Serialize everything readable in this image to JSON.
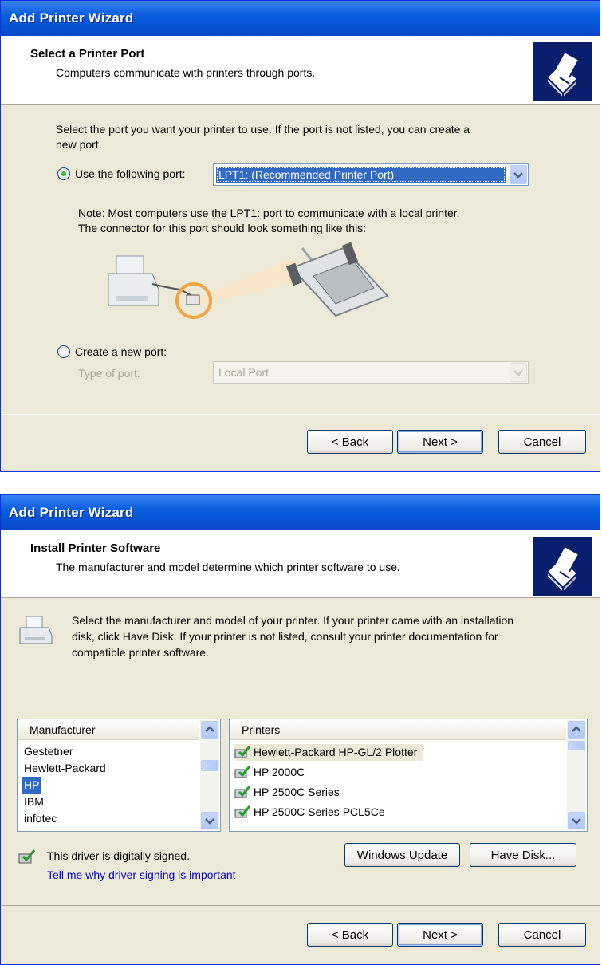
{
  "colors": {
    "title_bar": "#0a5fde",
    "dialog_bg": "#ece9d8",
    "selection": "#316ac5",
    "link": "#0000cc"
  },
  "wizard1": {
    "title": "Add Printer Wizard",
    "header_title": "Select a Printer Port",
    "header_subtitle": "Computers communicate with printers through ports.",
    "intro_line1": "Select the port you want your printer to use.  If the port is not listed, you can create a",
    "intro_line2": "new port.",
    "use_port_label": "Use the following port:",
    "port_value": "LPT1: (Recommended Printer Port)",
    "note_line1": "Note: Most computers use the LPT1: port to communicate with a local printer.",
    "note_line2": "The connector for this port should look something like this:",
    "create_port_label": "Create a new port:",
    "type_of_port_label": "Type of port:",
    "type_of_port_value": "Local Port",
    "back_label": "< Back",
    "next_label": "Next >",
    "cancel_label": "Cancel",
    "icons": [
      "printer-wizard-icon",
      "printer-illustration",
      "parallel-connector-illustration",
      "combo-arrow-icon"
    ]
  },
  "wizard2": {
    "title": "Add Printer Wizard",
    "header_title": "Install Printer Software",
    "header_subtitle": "The manufacturer and model determine which printer software to use.",
    "intro_line1": "Select the manufacturer and model of your printer. If your printer came with an installation",
    "intro_line2": "disk, click Have Disk. If your printer is not listed, consult your printer documentation for",
    "intro_line3": "compatible printer software.",
    "manufacturer_header": "Manufacturer",
    "manufacturers": [
      "Gestetner",
      "Hewlett-Packard",
      "HP",
      "IBM",
      "infotec"
    ],
    "selected_manufacturer": "HP",
    "printers_header": "Printers",
    "printers": [
      "Hewlett-Packard HP-GL/2 Plotter",
      "HP 2000C",
      "HP 2500C Series",
      "HP 2500C Series PCL5Ce"
    ],
    "signed_text": "This driver is digitally signed.",
    "signing_link": "Tell me why driver signing is important",
    "windows_update_label": "Windows Update",
    "have_disk_label": "Have Disk...",
    "back_label": "< Back",
    "next_label": "Next >",
    "cancel_label": "Cancel",
    "icons": [
      "printer-wizard-icon",
      "printer-icon",
      "signed-driver-icon",
      "scroll-up-icon",
      "scroll-down-icon"
    ]
  }
}
